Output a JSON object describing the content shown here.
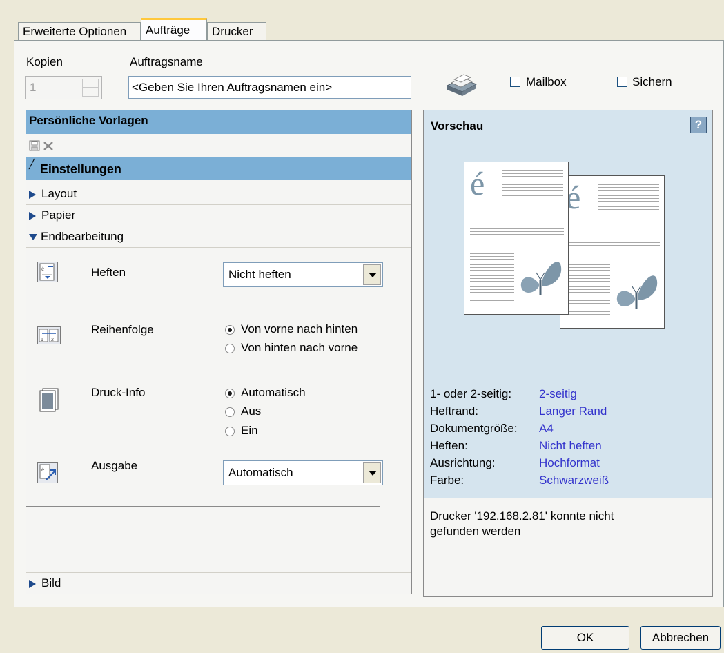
{
  "tabs": {
    "advanced": "Erweiterte Optionen",
    "jobs": "Aufträge",
    "printer": "Drucker"
  },
  "job": {
    "copies_label": "Kopien",
    "copies_value": "1",
    "jobname_label": "Auftragsname",
    "jobname_value": "<Geben Sie Ihren Auftragsnamen ein>",
    "mailbox_label": "Mailbox",
    "secure_label": "Sichern"
  },
  "templates": {
    "title": "Persönliche Vorlagen",
    "settings_title": "Einstellungen",
    "sections": {
      "layout": "Layout",
      "paper": "Papier",
      "finishing": "Endbearbeitung",
      "image": "Bild"
    }
  },
  "finishing": {
    "staple": {
      "label": "Heften",
      "value": "Nicht heften"
    },
    "order": {
      "label": "Reihenfolge",
      "options": [
        "Von vorne nach hinten",
        "Von hinten nach vorne"
      ],
      "selected": 0
    },
    "print_info": {
      "label": "Druck-Info",
      "options": [
        "Automatisch",
        "Aus",
        "Ein"
      ],
      "selected": 0
    },
    "output": {
      "label": "Ausgabe",
      "value": "Automatisch"
    }
  },
  "preview": {
    "title": "Vorschau",
    "help": "?",
    "page_letter": "é",
    "info": [
      {
        "label": "1- oder 2-seitig:",
        "value": "2-seitig"
      },
      {
        "label": "Heftrand:",
        "value": "Langer Rand"
      },
      {
        "label": "Dokumentgröße:",
        "value": "A4"
      },
      {
        "label": "Heften:",
        "value": "Nicht heften"
      },
      {
        "label": "Ausrichtung:",
        "value": "Hochformat"
      },
      {
        "label": "Farbe:",
        "value": "Schwarzweiß"
      }
    ],
    "status_message": "Drucker '192.168.2.81' konnte nicht gefunden werden"
  },
  "buttons": {
    "ok": "OK",
    "cancel": "Abbrechen"
  },
  "colors": {
    "header_blue": "#7bafd6",
    "preview_bg": "#d5e4ee",
    "value_text": "#3333cc",
    "window_bg": "#ece9d8"
  }
}
